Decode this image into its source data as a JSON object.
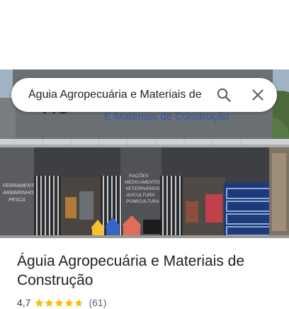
{
  "search": {
    "value": "Águia Agropecuária e Materiais de Construção"
  },
  "place": {
    "name": "Águia Agropecuária e Materiais de Construção",
    "rating": "4,7",
    "rating_fraction": 0.94,
    "reviews": "(61)"
  },
  "photo": {
    "sign_text": "E Materiais de Construção",
    "left_wall_text": [
      "FERRAMENTAS",
      "ARMARINHOS",
      "PESCA"
    ],
    "center_wall_text": [
      "RAÇÕES",
      "MEDICAMENTOS",
      "VETERINÁRIOS",
      "AVICULTURA",
      "POMICULTURA"
    ],
    "logo_fragment": "AG"
  },
  "colors": {
    "star": "#fbbc04",
    "star_empty": "#dadce0",
    "icon": "#5f6368",
    "sign_text": "#2d5fa6"
  },
  "icons": {
    "search": "search-icon",
    "close": "close-icon",
    "star": "star-icon"
  }
}
